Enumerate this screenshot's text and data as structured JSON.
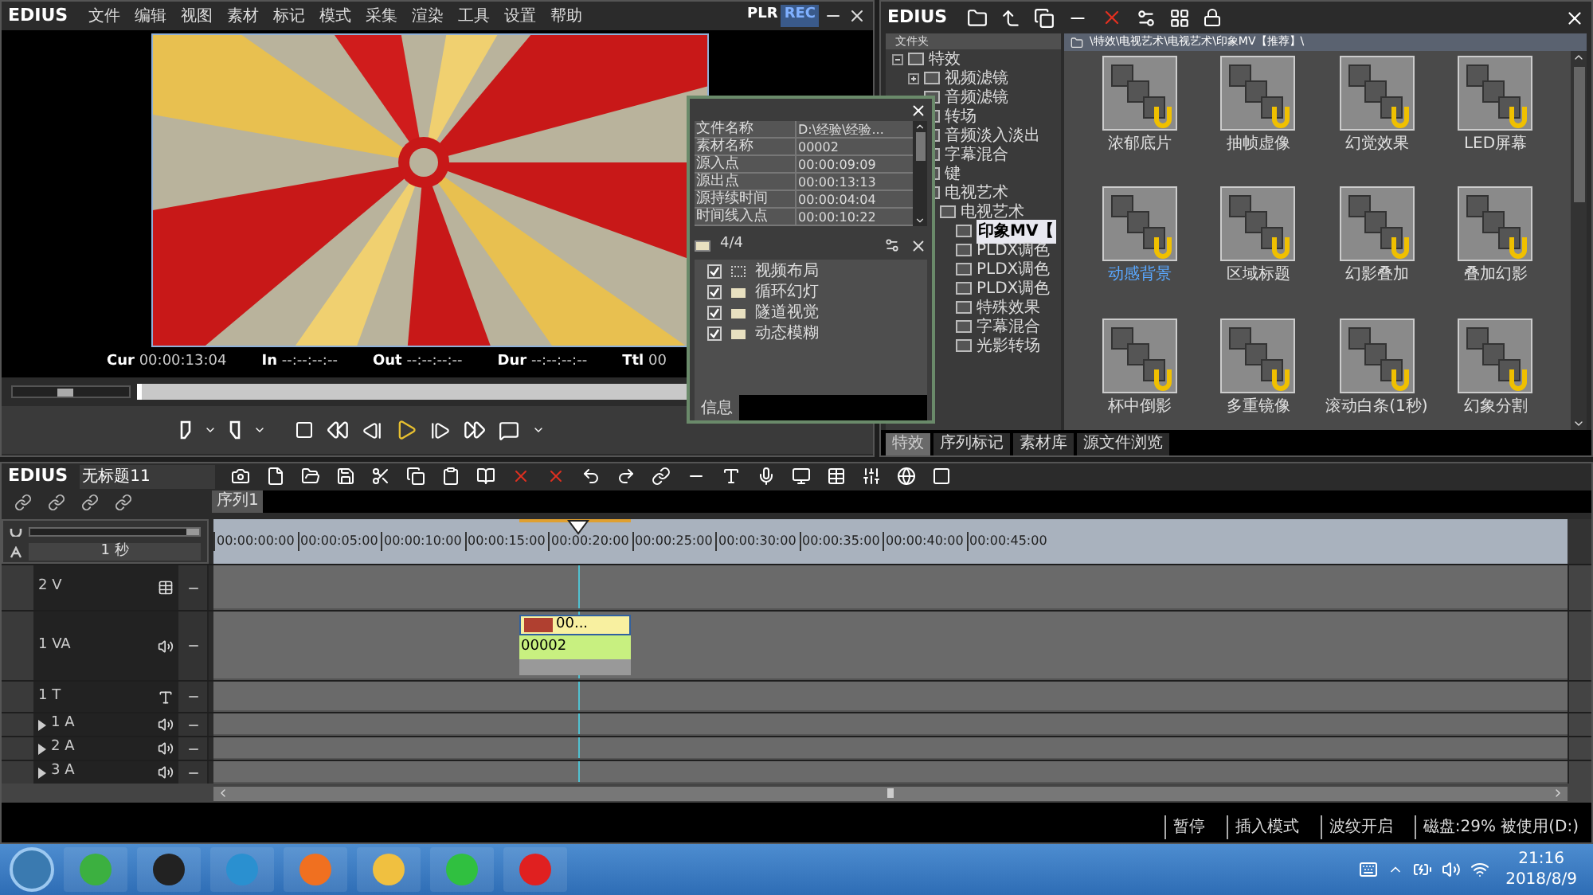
{
  "app": {
    "title": "EDIUS"
  },
  "menu": [
    "文件",
    "编辑",
    "视图",
    "素材",
    "标记",
    "模式",
    "采集",
    "渲染",
    "工具",
    "设置",
    "帮助"
  ],
  "player": {
    "modes": [
      {
        "label": "PLR",
        "selected": false
      },
      {
        "label": "REC",
        "selected": true
      }
    ],
    "shuttle": {
      "level": 0.45
    },
    "timecodes": [
      {
        "label": "Cur",
        "value": "00:00:13:04"
      },
      {
        "label": "In",
        "value": "--:--:--:--"
      },
      {
        "label": "Out",
        "value": "--:--:--:--"
      },
      {
        "label": "Dur",
        "value": "--:--:--:--"
      },
      {
        "label": "Ttl",
        "value": "00"
      }
    ]
  },
  "library": {
    "title": "EDIUS",
    "folder_header": "文件夹",
    "path": "\\特效\\电视艺术\\电视艺术\\印象MV【推荐】\\",
    "tree": [
      {
        "label": "特效",
        "expanded": true,
        "selected": false,
        "children": [
          {
            "label": "视频滤镜",
            "expanded": false,
            "selected": false
          },
          {
            "label": "音频滤镜",
            "selected": false
          },
          {
            "label": "转场",
            "selected": false
          },
          {
            "label": "音频淡入淡出",
            "selected": false
          },
          {
            "label": "字幕混合",
            "selected": false
          },
          {
            "label": "键",
            "selected": false
          },
          {
            "label": "电视艺术",
            "selected": false,
            "children": [
              {
                "label": "电视艺术",
                "selected": false,
                "children": [
                  {
                    "label": "印象MV【",
                    "selected": true
                  },
                  {
                    "label": "PLDX调色",
                    "selected": false
                  },
                  {
                    "label": "PLDX调色",
                    "selected": false
                  },
                  {
                    "label": "PLDX调色",
                    "selected": false
                  },
                  {
                    "label": "特殊效果",
                    "selected": false
                  },
                  {
                    "label": "字幕混合",
                    "selected": false
                  },
                  {
                    "label": "光影转场",
                    "selected": false
                  }
                ]
              }
            ]
          }
        ]
      }
    ],
    "items": [
      {
        "label": "浓郁底片",
        "selected": false
      },
      {
        "label": "抽帧虚像",
        "selected": false
      },
      {
        "label": "幻觉效果",
        "selected": false
      },
      {
        "label": "LED屏幕",
        "selected": false
      },
      {
        "label": "动感背景",
        "selected": true
      },
      {
        "label": "区域标题",
        "selected": false
      },
      {
        "label": "幻影叠加",
        "selected": false
      },
      {
        "label": "叠加幻影",
        "selected": false
      },
      {
        "label": "杯中倒影",
        "selected": false
      },
      {
        "label": "多重镜像",
        "selected": false
      },
      {
        "label": "滚动白条(1秒)",
        "selected": false
      },
      {
        "label": "幻象分割",
        "selected": false
      }
    ],
    "tabs": [
      {
        "label": "特效",
        "selected": true
      },
      {
        "label": "序列标记",
        "selected": false
      },
      {
        "label": "素材库",
        "selected": false
      },
      {
        "label": "源文件浏览",
        "selected": false
      }
    ]
  },
  "info_window": {
    "rows": [
      {
        "name": "文件名称",
        "value": "D:\\经验\\经验..."
      },
      {
        "name": "素材名称",
        "value": "00002"
      },
      {
        "name": "源入点",
        "value": "00:00:09:09"
      },
      {
        "name": "源出点",
        "value": "00:00:13:13"
      },
      {
        "name": "源持续时间",
        "value": "00:00:04:04"
      },
      {
        "name": "时间线入点",
        "value": "00:00:10:22"
      }
    ],
    "count": "4/4",
    "effects": [
      {
        "label": "视频布局",
        "checked": true,
        "kind": "layout"
      },
      {
        "label": "循环幻灯",
        "checked": true,
        "kind": "filter"
      },
      {
        "label": "隧道视觉",
        "checked": true,
        "kind": "filter"
      },
      {
        "label": "动态模糊",
        "checked": true,
        "kind": "filter"
      }
    ],
    "tab": "信息"
  },
  "timeline": {
    "title": "EDIUS",
    "project": "无标题11",
    "sequence_tab": "序列1",
    "zoom": "1 秒",
    "zoom_slider": {
      "level": 1
    },
    "ruler": [
      "00:00:00:00",
      "00:00:05:00",
      "00:00:10:00",
      "00:00:15:00",
      "00:00:20:00",
      "00:00:25:00",
      "00:00:30:00",
      "00:00:35:00",
      "00:00:40:00",
      "00:00:45:00"
    ],
    "tracks": [
      {
        "label": "2 V",
        "kind": "video"
      },
      {
        "label": "1 VA",
        "kind": "videoaudio",
        "clip": {
          "title": "00...",
          "name": "00002"
        }
      },
      {
        "label": "1 T",
        "kind": "title"
      },
      {
        "label": "1 A",
        "kind": "audio"
      },
      {
        "label": "2 A",
        "kind": "audio"
      },
      {
        "label": "3 A",
        "kind": "audio"
      }
    ]
  },
  "status_bar": [
    "暂停",
    "插入模式",
    "波纹开启",
    "磁盘:29% 被使用(D:)"
  ],
  "taskbar": {
    "time": "21:16",
    "date": "2018/8/9"
  }
}
